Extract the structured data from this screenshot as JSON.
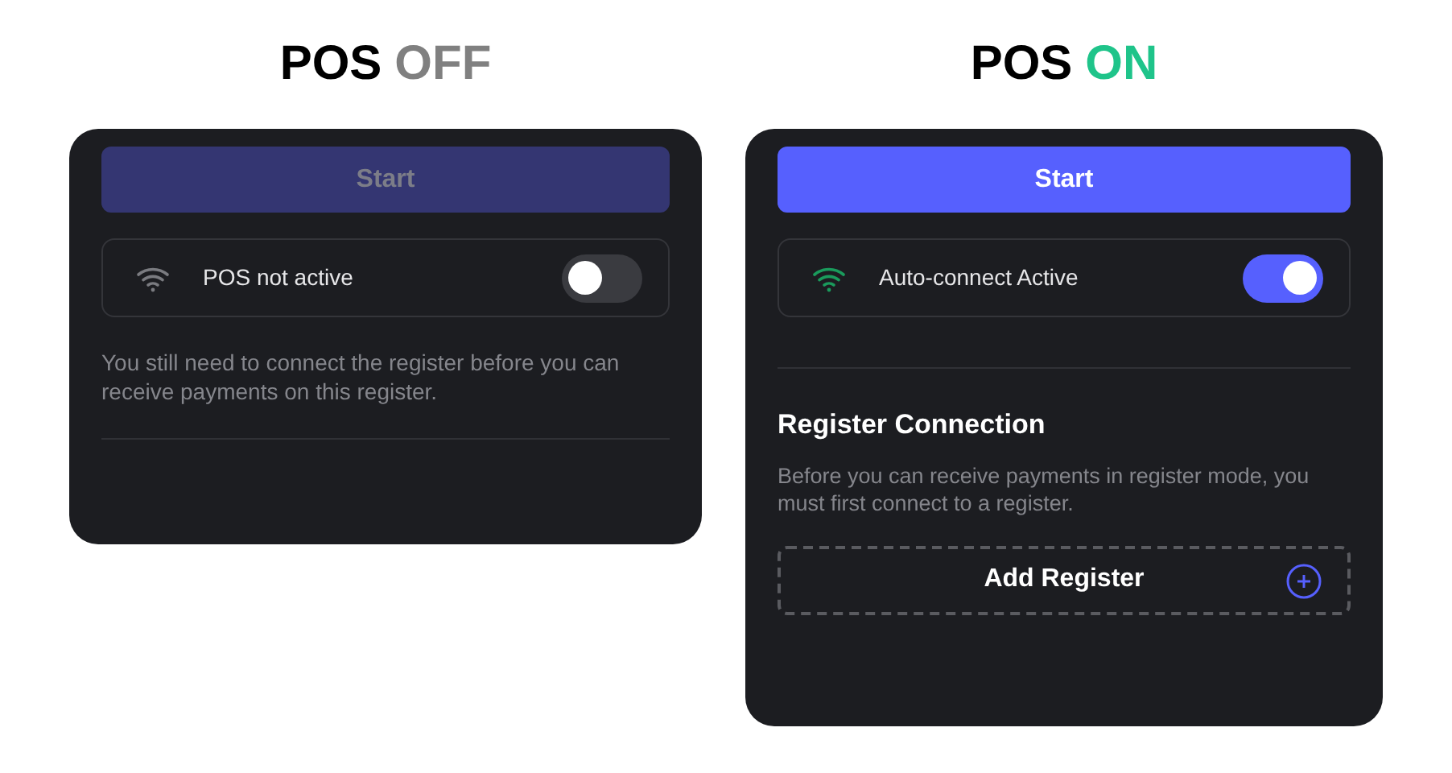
{
  "panels": [
    {
      "heading": {
        "label": "POS",
        "status": "OFF",
        "on": false
      },
      "start_button": {
        "label": "Start",
        "disabled": true
      },
      "connection": {
        "label": "POS not active",
        "on": false
      },
      "note": "You still need to connect the register before you can receive payments on this register."
    },
    {
      "heading": {
        "label": "POS",
        "status": "ON",
        "on": true
      },
      "start_button": {
        "label": "Start",
        "disabled": false
      },
      "connection": {
        "label": "Auto-connect Active",
        "on": true
      },
      "register": {
        "title": "Register Connection",
        "description": "Before you can receive payments in register mode, you must first connect to a register.",
        "add_button": "Add Register"
      }
    }
  ]
}
